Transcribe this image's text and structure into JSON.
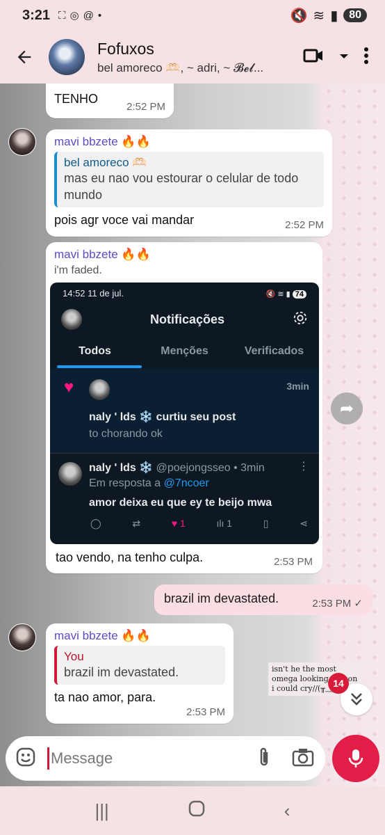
{
  "status_bar": {
    "time": "3:21",
    "battery": "80"
  },
  "header": {
    "title": "Fofuxos",
    "subtitle": "bel amoreco 🫶🏻, ~ adri, ~ 𝓑𝓮𝓵..."
  },
  "messages": {
    "m1": {
      "text": "TENHO",
      "time": "2:52 PM"
    },
    "m2": {
      "sender": "mavi bbzete 🔥🔥",
      "reply_name": "bel amoreco 🫶🏻",
      "reply_text": "mas eu nao vou estourar o celular de todo mundo",
      "text": "pois agr voce vai mandar",
      "time": "2:52 PM"
    },
    "m3": {
      "sender": "mavi bbzete 🔥🔥",
      "forward_caption": "i'm faded.",
      "text": "tao vendo, na tenho culpa.",
      "time": "2:53 PM"
    },
    "m4": {
      "text": "brazil im devastated.",
      "time": "2:53 PM ✓"
    },
    "m5": {
      "sender": "mavi bbzete 🔥🔥",
      "reply_name": "You",
      "reply_text": "brazil im devastated.",
      "text": "ta nao amor, para.",
      "time": "2:53 PM"
    }
  },
  "embedded": {
    "status_time": "14:52  11 de jul.",
    "status_battery": "74",
    "title": "Notificações",
    "tabs": [
      "Todos",
      "Menções",
      "Verificados"
    ],
    "notif1": {
      "time": "3min",
      "line": "naly ' lds ❄️ curtiu seu post",
      "post": "to chorando ok"
    },
    "notif2": {
      "name": "naly ' lds ❄️",
      "handle": "@poejongsseo • 3min",
      "reply_prefix": "Em resposta a ",
      "reply_handle": "@7ncoer",
      "text": "amor deixa eu que ey te beijo mwa",
      "likes": "1",
      "views": "1"
    }
  },
  "sticker_text": "isn't he the most omega looking person i could cry//(╥﹏╥",
  "unread_count": "14",
  "input": {
    "placeholder": "Message"
  },
  "icons": {
    "back": "arrow-left-icon",
    "video": "video-call-icon",
    "more": "more-vert-icon",
    "emoji": "emoji-icon",
    "attach": "paperclip-icon",
    "camera": "camera-icon",
    "mic": "mic-icon",
    "forward": "forward-icon",
    "scroll_down": "double-chevron-down-icon"
  },
  "colors": {
    "accent": "#e11d48",
    "sender": "#5b4ac5",
    "outgoing": "#fbdde4"
  }
}
